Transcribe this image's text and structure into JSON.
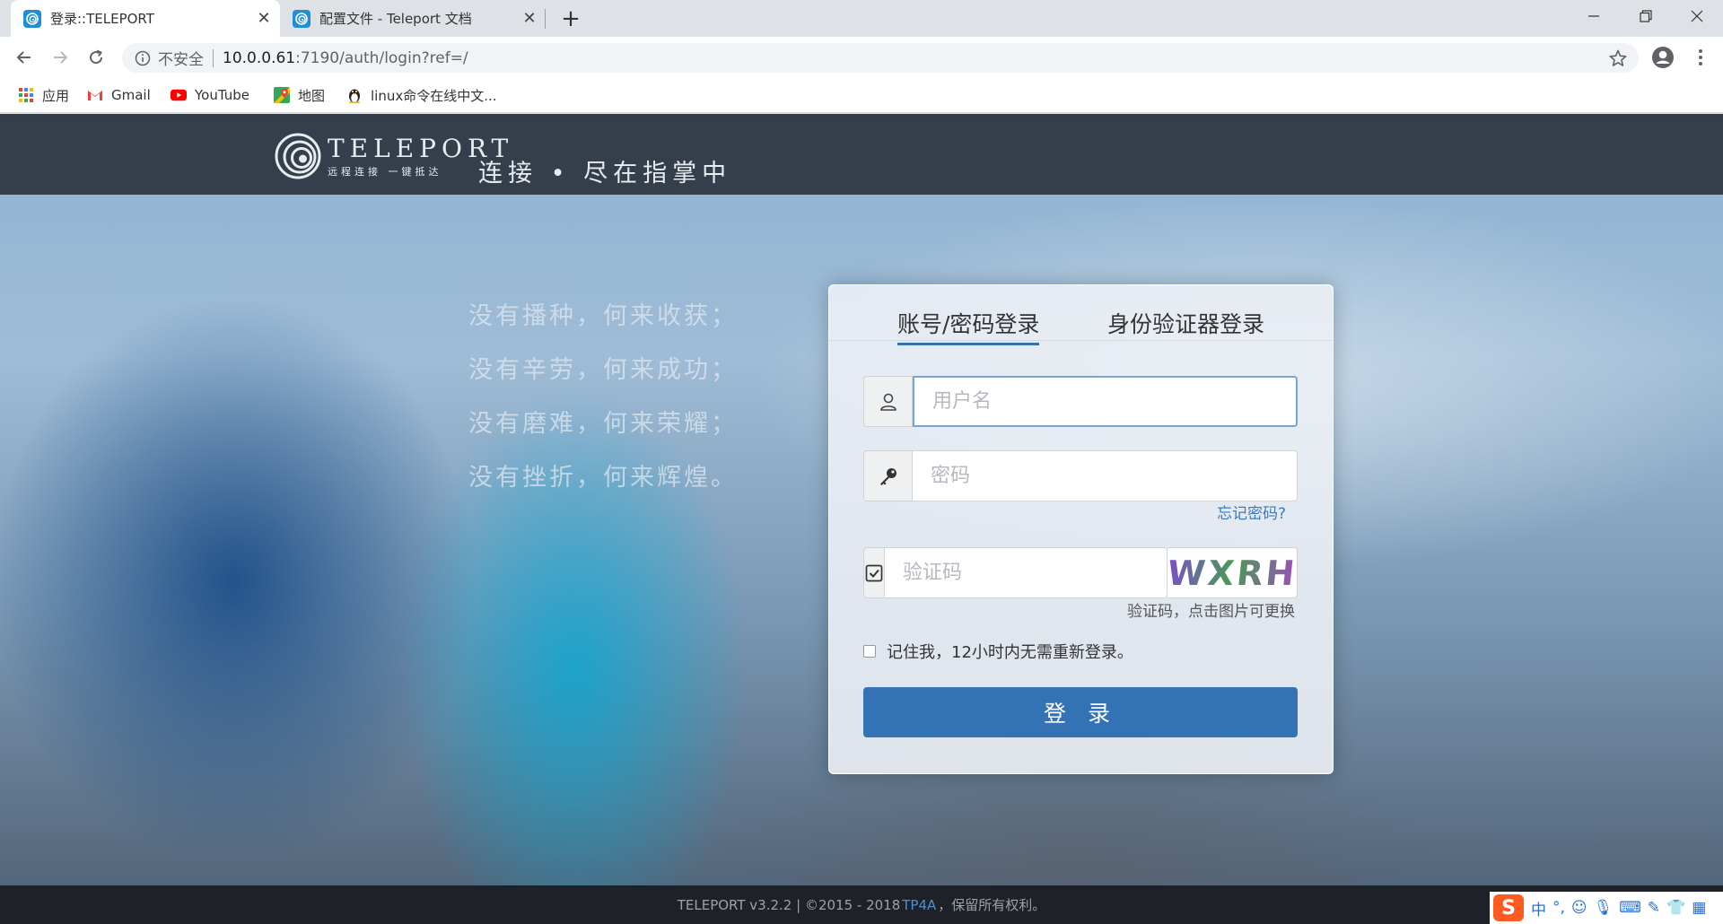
{
  "browser": {
    "tabs": [
      {
        "title": "登录::TELEPORT",
        "active": true
      },
      {
        "title": "配置文件 - Teleport 文档",
        "active": false
      }
    ],
    "omnibox": {
      "security_label": "不安全",
      "url_host": "10.0.0.61",
      "url_path": ":7190/auth/login?ref=/"
    },
    "bookmarks": [
      {
        "label": "应用",
        "icon": "apps-grid-icon"
      },
      {
        "label": "Gmail",
        "icon": "gmail-icon"
      },
      {
        "label": "YouTube",
        "icon": "youtube-icon"
      },
      {
        "label": "地图",
        "icon": "maps-icon"
      },
      {
        "label": "linux命令在线中文...",
        "icon": "penguin-icon"
      }
    ]
  },
  "header": {
    "brand_name": "TELEPORT",
    "brand_sub": "远程连接 一键抵达",
    "slogan": "连接 • 尽在指掌中"
  },
  "poem": [
    "没有播种，何来收获；",
    "没有辛劳，何来成功；",
    "没有磨难，何来荣耀；",
    "没有挫折，何来辉煌。"
  ],
  "login": {
    "tab_password": "账号/密码登录",
    "tab_authenticator": "身份验证器登录",
    "username_placeholder": "用户名",
    "password_placeholder": "密码",
    "forgot_password": "忘记密码?",
    "captcha_placeholder": "验证码",
    "captcha_text": "WXRH",
    "captcha_hint": "验证码，点击图片可更换",
    "remember_label": "记住我，12小时内无需重新登录。",
    "submit_label": "登 录"
  },
  "footer": {
    "prefix": "TELEPORT v3.2.2 | ©2015 - 2018 ",
    "link": "TP4A",
    "suffix": "，保留所有权利。"
  },
  "ime": {
    "logo": "S",
    "lang": "中"
  },
  "colors": {
    "primary": "#3373b5",
    "header_bg": "#282e38",
    "footer_bg": "#1e2228"
  }
}
